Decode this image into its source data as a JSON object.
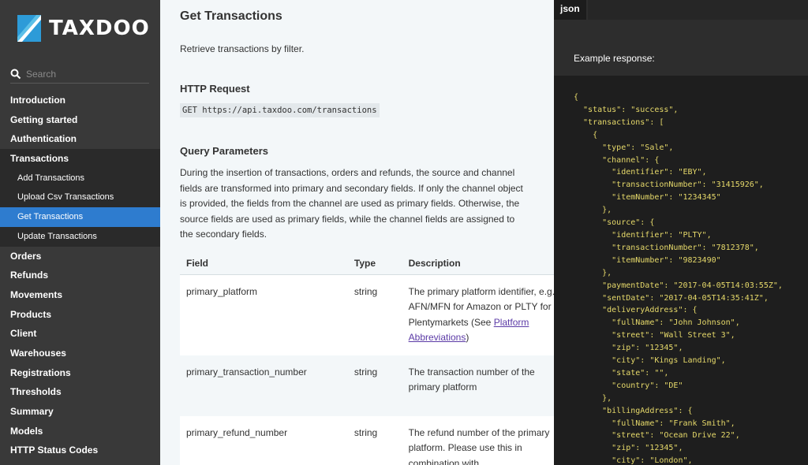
{
  "brand": {
    "name": "TAXDOO"
  },
  "search": {
    "placeholder": "Search"
  },
  "nav": {
    "top_items": [
      "Introduction",
      "Getting started",
      "Authentication"
    ],
    "group_label": "Transactions",
    "sub_items": [
      "Add Transactions",
      "Upload Csv Transactions",
      "Get Transactions",
      "Update Transactions"
    ],
    "active_sub": "Get Transactions",
    "bottom_items": [
      "Orders",
      "Refunds",
      "Movements",
      "Products",
      "Client",
      "Warehouses",
      "Registrations",
      "Thresholds",
      "Summary",
      "Models",
      "HTTP Status Codes"
    ]
  },
  "main": {
    "title": "Get Transactions",
    "intro": "Retrieve transactions by filter.",
    "http_request_heading": "HTTP Request",
    "http_request": "GET https://api.taxdoo.com/transactions",
    "query_heading": "Query Parameters",
    "query_text": "During the insertion of transactions, orders and refunds, the source and channel fields are transformed into primary and secondary fields. If only the channel object is provided, the fields from the channel are used as primary fields. Otherwise, the source fields are used as primary fields, while the channel fields are assigned to the secondary fields.",
    "table": {
      "headers": [
        "Field",
        "Type",
        "Description"
      ],
      "rows": [
        {
          "field": "primary_platform",
          "type": "string",
          "desc_pre": "The primary platform identifier, e.g. AFN/MFN for Amazon or PLTY for Plentymarkets (See ",
          "desc_link": "Platform Abbreviations",
          "desc_post": ")"
        },
        {
          "field": "primary_transaction_number",
          "type": "string",
          "desc": "The transaction number of the primary platform"
        },
        {
          "field": "primary_refund_number",
          "type": "string",
          "desc": "The refund number of the primary platform. Please use this in combination with"
        }
      ]
    }
  },
  "right": {
    "tab": "json",
    "example_label": "Example response:",
    "code": "{\n  \"status\": \"success\",\n  \"transactions\": [\n    {\n      \"type\": \"Sale\",\n      \"channel\": {\n        \"identifier\": \"EBY\",\n        \"transactionNumber\": \"31415926\",\n        \"itemNumber\": \"1234345\"\n      },\n      \"source\": {\n        \"identifier\": \"PLTY\",\n        \"transactionNumber\": \"7812378\",\n        \"itemNumber\": \"9823490\"\n      },\n      \"paymentDate\": \"2017-04-05T14:03:55Z\",\n      \"sentDate\": \"2017-04-05T14:35:41Z\",\n      \"deliveryAddress\": {\n        \"fullName\": \"John Johnson\",\n        \"street\": \"Wall Street 3\",\n        \"zip\": \"12345\",\n        \"city\": \"Kings Landing\",\n        \"state\": \"\",\n        \"country\": \"DE\"\n      },\n      \"billingAddress\": {\n        \"fullName\": \"Frank Smith\",\n        \"street\": \"Ocean Drive 22\",\n        \"zip\": \"12345\",\n        \"city\": \"London\","
  }
}
